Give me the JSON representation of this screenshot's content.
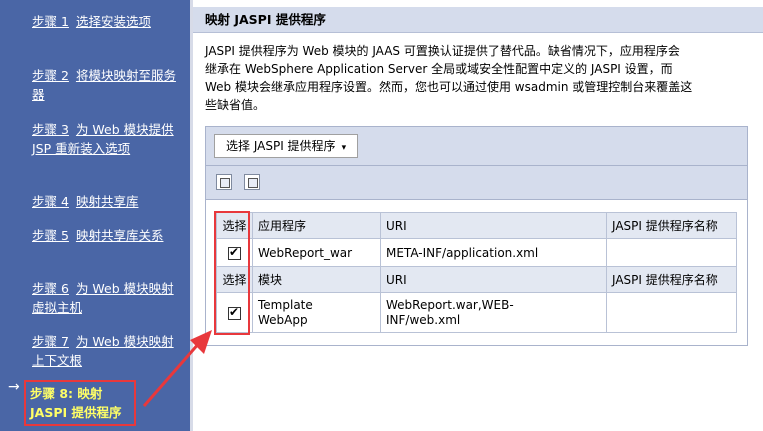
{
  "sidebar": {
    "steps": [
      {
        "num": "步骤 1",
        "text": "选择安装选项"
      },
      {
        "num": "步骤 2",
        "text": "将模块映射至服务器"
      },
      {
        "num": "步骤 3",
        "text": "为 Web 模块提供 JSP 重新装入选项"
      },
      {
        "num": "步骤 4",
        "text": "映射共享库"
      },
      {
        "num": "步骤 5",
        "text": "映射共享库关系"
      },
      {
        "num": "步骤 6",
        "text": "为 Web 模块映射虚拟主机"
      },
      {
        "num": "步骤 7",
        "text": "为 Web 模块映射上下文根"
      }
    ],
    "current_arrow": "→",
    "current_line1": "步骤 8: 映射",
    "current_line2": "JASPI 提供程序"
  },
  "header": {
    "title": "映射 JASPI 提供程序"
  },
  "description": {
    "line1": "JASPI 提供程序为 Web 模块的 JAAS 可置换认证提供了替代品。缺省情况下，应用程序会",
    "line2": "继承在 WebSphere Application Server 全局或域安全性配置中定义的 JASPI 设置，而",
    "line3": "Web 模块会继承应用程序设置。然而，您也可以通过使用 wsadmin 或管理控制台来覆盖这",
    "line4": "些缺省值。"
  },
  "toolbar": {
    "select_label": "选择 JASPI 提供程序",
    "caret": "▾"
  },
  "icons": {
    "icon1": "select-all-icon",
    "icon2": "deselect-all-icon"
  },
  "table": {
    "app_header": {
      "select": "选择",
      "name": "应用程序",
      "uri": "URI",
      "provider": "JASPI 提供程序名称"
    },
    "app_row": {
      "checked": true,
      "name": "WebReport_war",
      "uri": "META-INF/application.xml",
      "provider": ""
    },
    "mod_header": {
      "select": "选择",
      "name": "模块",
      "uri": "URI",
      "provider": "JASPI 提供程序名称"
    },
    "mod_row": {
      "checked": true,
      "name_line1": "Template",
      "name_line2": "WebApp",
      "uri_line1": "WebReport.war,WEB-",
      "uri_line2": "INF/web.xml",
      "provider": ""
    }
  },
  "colors": {
    "sidebar": "#4a66a6",
    "header": "#d5dcec",
    "annotation": "#e8383c",
    "current_step": "#ffff66"
  }
}
